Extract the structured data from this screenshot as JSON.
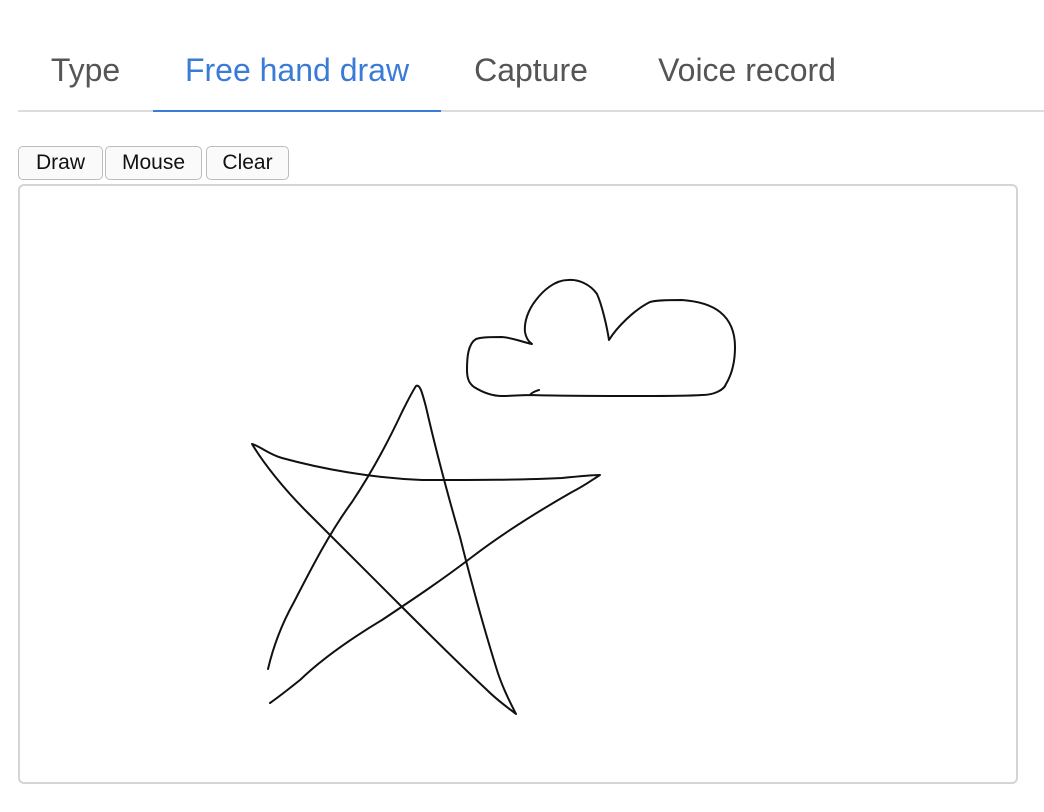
{
  "tabs": [
    {
      "label": "Type",
      "active": false
    },
    {
      "label": "Free hand draw",
      "active": true
    },
    {
      "label": "Capture",
      "active": false
    },
    {
      "label": "Voice record",
      "active": false
    }
  ],
  "toolbar": {
    "draw_label": "Draw",
    "mouse_label": "Mouse",
    "clear_label": "Clear"
  },
  "colors": {
    "accent": "#3a7bd5",
    "tab_text": "#555555",
    "stroke": "#111111"
  },
  "drawing": {
    "shapes": [
      "star",
      "cloud"
    ]
  }
}
